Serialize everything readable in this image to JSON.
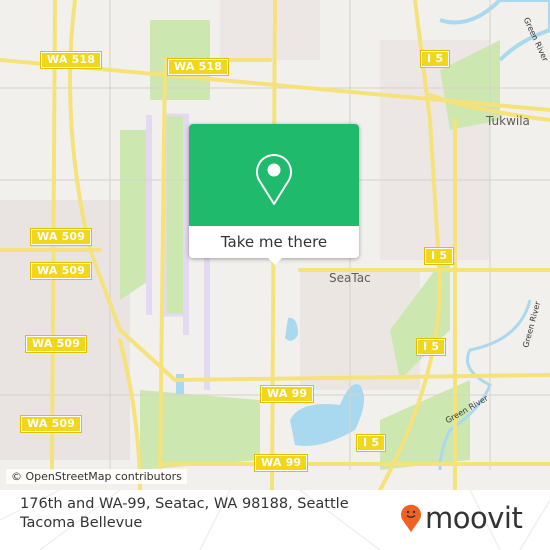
{
  "map": {
    "places": {
      "tukwila": "Tukwila",
      "seatac": "SeaTac"
    },
    "rivers": {
      "green_river_1": "Green River",
      "green_river_2": "Green River",
      "green_river_3": "Green River"
    },
    "shields": {
      "wa518_a": "WA 518",
      "wa518_b": "WA 518",
      "i5_a": "I 5",
      "i5_b": "I 5",
      "i5_c": "I 5",
      "i5_d": "I 5",
      "wa509_a": "WA 509",
      "wa509_b": "WA 509",
      "wa509_c": "WA 509",
      "wa99_a": "WA 99",
      "wa99_b": "WA 99"
    },
    "attribution": "© OpenStreetMap contributors",
    "colors": {
      "land": "#f2f0ec",
      "road": "#f6e27a",
      "water": "#a9d9ef",
      "park": "#cde7b0",
      "runway": "#e4d9f2",
      "popup_green": "#1fba6b"
    }
  },
  "popup": {
    "button_label": "Take me there",
    "icon": "location-pin-icon"
  },
  "footer": {
    "address": "176th and WA-99, Seatac, WA 98188, Seattle Tacoma Bellevue",
    "logo_text": "moovit",
    "logo_icon": "moovit-pin-icon",
    "brand_color": "#f16122"
  }
}
